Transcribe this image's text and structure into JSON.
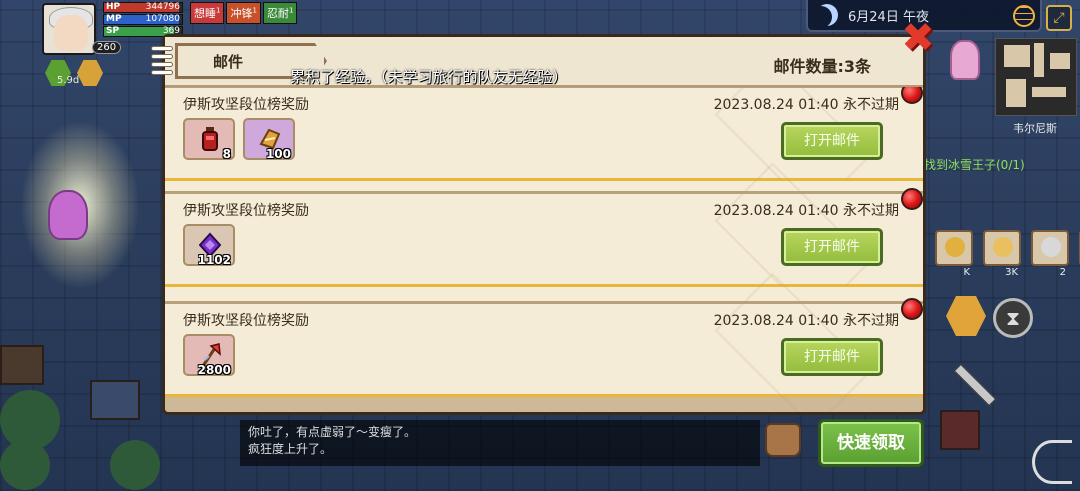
{
  "hud": {
    "hp_label": "HP",
    "hp_value": "344796",
    "mp_label": "MP",
    "mp_value": "107080",
    "sp_label": "SP",
    "sp_value": "369",
    "level": "260",
    "speed": "5.9d",
    "buffs": [
      {
        "label": "想睡",
        "count": "1",
        "color": "#c83a3a"
      },
      {
        "label": "冲锋",
        "count": "1",
        "color": "#c8502a"
      },
      {
        "label": "忍耐",
        "count": "1",
        "color": "#3a8a3a"
      }
    ],
    "date": "6月24日 午夜",
    "region": "韦尔尼斯",
    "quest": "找到冰雪王子(0/1)",
    "slot_counts": [
      "K",
      "3K",
      "2",
      ""
    ],
    "quick_claim_label": "快速领取"
  },
  "chat": {
    "lines": [
      "你吐了，有点虚弱了～变瘦了。",
      "疯狂度上升了。"
    ]
  },
  "mail": {
    "tab_label": "邮件",
    "count_label": "邮件数量:3条",
    "toast": "累积了经验。（未学习旅行的队友无经验）",
    "items": [
      {
        "title": "伊斯攻坚段位榜奖励",
        "date": "2023.08.24 01:40  永不过期",
        "open_label": "打开邮件",
        "rewards": [
          {
            "icon": "red-potion-icon",
            "qty": "8",
            "bg": "red"
          },
          {
            "icon": "gold-ingot-icon",
            "qty": "100",
            "bg": "purple"
          }
        ]
      },
      {
        "title": "伊斯攻坚段位榜奖励",
        "date": "2023.08.24 01:40  永不过期",
        "open_label": "打开邮件",
        "rewards": [
          {
            "icon": "purple-emblem-icon",
            "qty": "1102",
            "bg": "tan"
          }
        ]
      },
      {
        "title": "伊斯攻坚段位榜奖励",
        "date": "2023.08.24 01:40  永不过期",
        "open_label": "打开邮件",
        "rewards": [
          {
            "icon": "red-axe-icon",
            "qty": "2800",
            "bg": "red"
          }
        ]
      }
    ]
  }
}
